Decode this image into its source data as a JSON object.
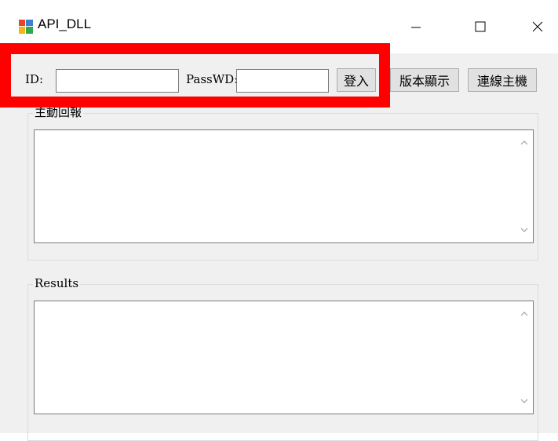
{
  "window": {
    "title": "API_DLL",
    "minimize_glyph": "—",
    "close_glyph": "✕"
  },
  "login": {
    "id_label": "ID:",
    "id_value": "",
    "password_label": "PassWD:",
    "password_value": "",
    "login_button": "登入"
  },
  "toolbar": {
    "version_button": "版本顯示",
    "connect_button": "連線主機"
  },
  "groups": {
    "active_report": {
      "title": "主動回報",
      "content": ""
    },
    "results": {
      "title": "Results",
      "content": ""
    }
  },
  "colors": {
    "highlight": "#ff0000",
    "window_bg": "#f0f0f0"
  },
  "icons": [
    "app-icon",
    "minimize-icon",
    "maximize-icon",
    "close-icon",
    "scroll-up-icon",
    "scroll-down-icon"
  ]
}
